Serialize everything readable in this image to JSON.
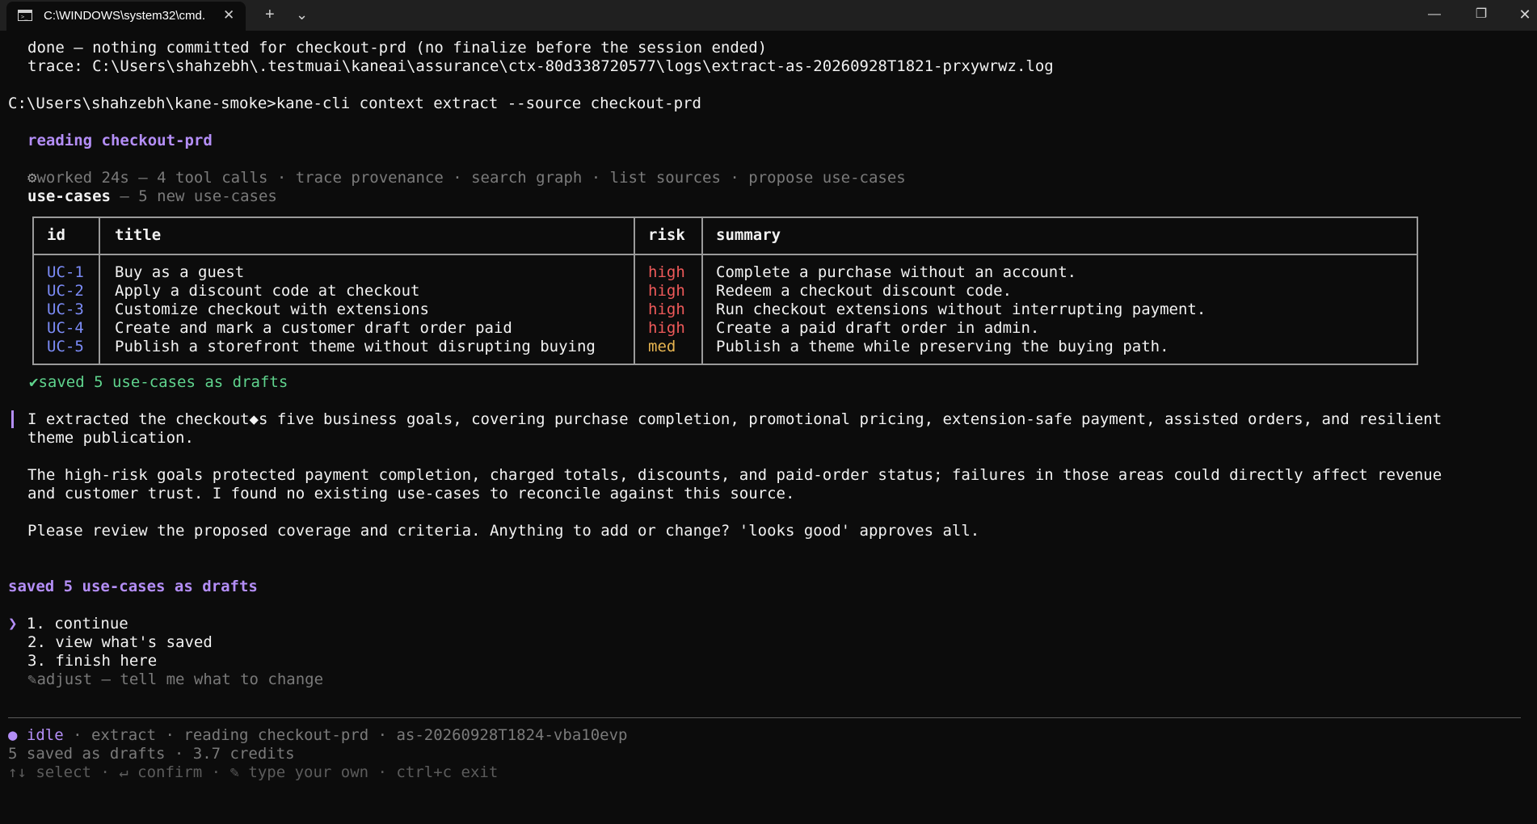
{
  "window": {
    "tab_title": "C:\\WINDOWS\\system32\\cmd.",
    "tab_icon": "cmd-icon",
    "new_tab_glyph": "+",
    "dropdown_glyph": "⌄",
    "close_tab_glyph": "✕",
    "minimize_glyph": "—",
    "maximize_glyph": "❐",
    "close_glyph": "✕"
  },
  "prev": {
    "done_line": "done — nothing committed for checkout-prd (no finalize before the session ended)",
    "trace_line": "trace: C:\\Users\\shahzebh\\.testmuai\\kaneai\\assurance\\ctx-80d338720577\\logs\\extract-as-20260928T1821-prxywrwz.log"
  },
  "command": {
    "prompt": "C:\\Users\\shahzebh\\kane-smoke>",
    "text": "kane-cli context extract --source checkout-prd"
  },
  "reading": "reading checkout-prd",
  "worked": {
    "icon": "gear-icon",
    "text": "worked 24s — 4 tool calls · trace provenance · search graph · list sources · propose use-cases"
  },
  "usecases_header": {
    "label": "use-cases",
    "suffix": " — 5 new use-cases"
  },
  "table": {
    "headers": [
      "id",
      "title",
      "risk",
      "summary"
    ],
    "rows": [
      {
        "id": "UC-1",
        "title": "Buy as a guest",
        "risk": "high",
        "summary": "Complete a purchase without an account."
      },
      {
        "id": "UC-2",
        "title": "Apply a discount code at checkout",
        "risk": "high",
        "summary": "Redeem a checkout discount code."
      },
      {
        "id": "UC-3",
        "title": "Customize checkout with extensions",
        "risk": "high",
        "summary": "Run checkout extensions without interrupting payment."
      },
      {
        "id": "UC-4",
        "title": "Create and mark a customer draft order paid",
        "risk": "high",
        "summary": "Create a paid draft order in admin."
      },
      {
        "id": "UC-5",
        "title": "Publish a storefront theme without disrupting buying",
        "risk": "med",
        "summary": "Publish a theme while preserving the buying path."
      }
    ],
    "risk_colors": {
      "high": "#ef5a5a",
      "med": "#e6b450"
    }
  },
  "saved_check": {
    "icon": "check-icon",
    "text": "saved 5 use-cases as drafts"
  },
  "message": {
    "p1_line1": "I extracted the checkout◆s five business goals, covering purchase completion, promotional pricing, extension-safe payment, assisted orders, and resilient",
    "p1_line2": "theme publication.",
    "p2_line1": "The high-risk goals protected payment completion, charged totals, discounts, and paid-order status; failures in those areas could directly affect revenue",
    "p2_line2": "and customer trust. I found no existing use-cases to reconcile against this source.",
    "p3": "Please review the proposed coverage and criteria. Anything to add or change? 'looks good' approves all."
  },
  "saved_heading": "saved 5 use-cases as drafts",
  "menu": {
    "cursor": "❯",
    "options": [
      "1. continue",
      "2. view what's saved",
      "3. finish here"
    ],
    "adjust_icon": "pencil-icon",
    "adjust": "adjust — tell me what to change"
  },
  "status": {
    "dot": "●",
    "state": "idle",
    "details": " · extract · reading checkout-prd · as-20260928T1824-vba10evp",
    "line2": "5 saved as drafts · 3.7 credits",
    "hints": "↑↓ select · ↵ confirm · ✎ type your own · ctrl+c exit"
  },
  "colors": {
    "background": "#0c0c0c",
    "accent_purple": "#b48ef7",
    "success_green": "#5fd38d",
    "id_blue": "#7c8cf7"
  }
}
